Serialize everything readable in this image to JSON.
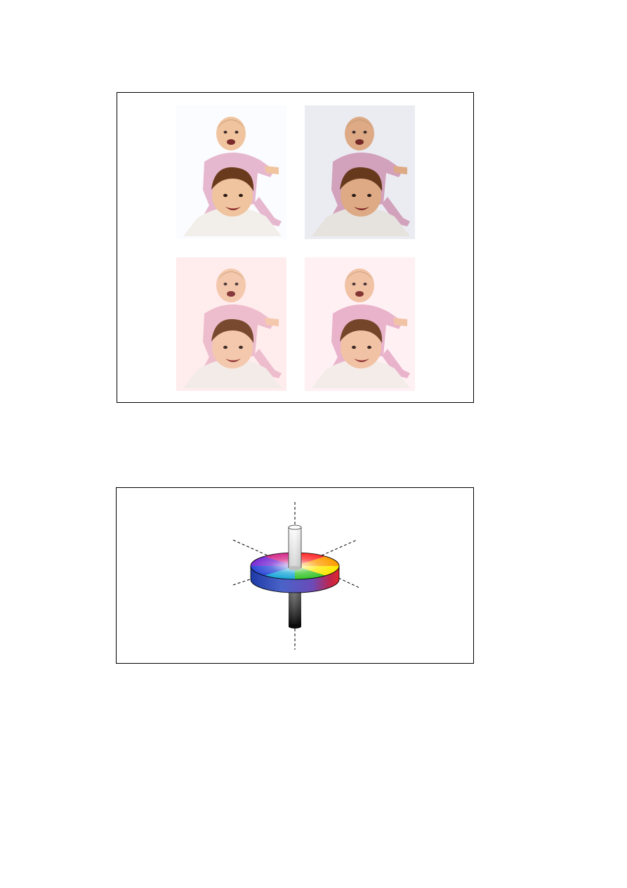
{
  "page": {
    "figures": [
      {
        "id": "photo-grid",
        "kind": "photo-grid",
        "photos": [
          {
            "tint_background": "#fbfcff",
            "tint_overlay": "#ffffff",
            "overlay_opacity": 0.0,
            "skin": "#f0c49e",
            "shirt": "#e6b8cf"
          },
          {
            "tint_background": "#f7f8ff",
            "tint_overlay": "#3b2a2a",
            "overlay_opacity": 0.06,
            "skin": "#e8b38c",
            "shirt": "#dca9c5"
          },
          {
            "tint_background": "#fff0f0",
            "tint_overlay": "#ffd0d8",
            "overlay_opacity": 0.1,
            "skin": "#f3c8a8",
            "shirt": "#ecbccc"
          },
          {
            "tint_background": "#fff3f7",
            "tint_overlay": "#ffc8dc",
            "overlay_opacity": 0.08,
            "skin": "#f0c2a0",
            "shirt": "#e8b2ca"
          }
        ]
      },
      {
        "id": "color-cylinder",
        "kind": "diagram",
        "wheel_colors": [
          "#ff2a2a",
          "#ff9d00",
          "#ffe800",
          "#36c42a",
          "#19a7d8",
          "#2c49d8",
          "#7a2cd4",
          "#d42a8a"
        ],
        "side_gradient": [
          "#1e3aa6",
          "#4a63c8",
          "#6b4bb8",
          "#c0244c",
          "#e0282a"
        ],
        "axis_top": "#ffffff",
        "axis_bottom": "#000000"
      }
    ]
  }
}
